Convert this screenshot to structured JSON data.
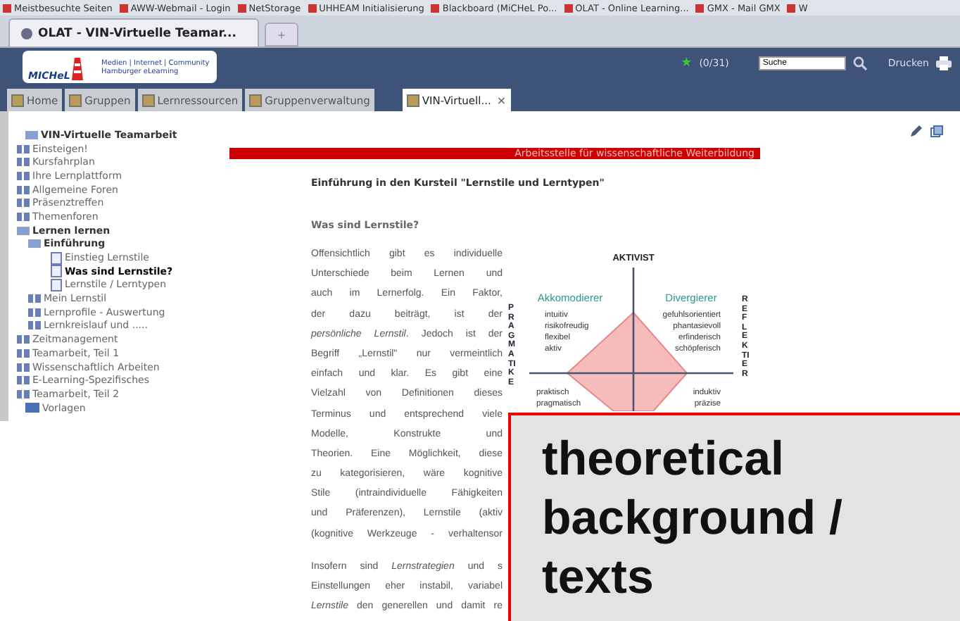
{
  "bookmarks": [
    "Meistbesuchte Seiten",
    "AWW-Webmail - Login",
    "NetStorage",
    "UHHEAM Initialisierung",
    "Blackboard (MiCHeL Po...",
    "OLAT - Online Learning...",
    "GMX - Mail GMX",
    "W"
  ],
  "browser_tab": {
    "title": "OLAT - VIN-Virtuelle Teamar...",
    "new_tab": "+"
  },
  "header": {
    "star": "★",
    "logo_name": "MICHeL",
    "logo_lines": [
      "Medien | Internet | Community",
      "Hamburger eLearning"
    ],
    "count": "(0/31)",
    "search": {
      "value": "Suche"
    },
    "print": "Drucken"
  },
  "tabs": [
    {
      "label": "Home",
      "selected": false
    },
    {
      "label": "Gruppen",
      "selected": false
    },
    {
      "label": "Lernressourcen",
      "selected": false
    },
    {
      "label": "Gruppenverwaltung",
      "selected": false
    },
    {
      "label": "VIN-Virtuell...",
      "selected": true,
      "close": "×"
    }
  ],
  "sidebar": {
    "items": [
      {
        "label": "VIN-Virtuelle Teamarbeit",
        "kind": "node",
        "expanded": true,
        "selected": false,
        "children": [
          {
            "label": "Einsteigen!",
            "kind": "node",
            "expanded": false,
            "selected": false
          },
          {
            "label": "Kursfahrplan",
            "kind": "node",
            "expanded": false,
            "selected": false
          },
          {
            "label": "Ihre Lernplattform",
            "kind": "node",
            "expanded": false,
            "selected": false
          },
          {
            "label": "Allgemeine Foren",
            "kind": "node",
            "expanded": false,
            "selected": false
          },
          {
            "label": "Präsenztreffen",
            "kind": "node",
            "expanded": false,
            "selected": false
          },
          {
            "label": "Themenforen",
            "kind": "node",
            "expanded": false,
            "selected": false
          },
          {
            "label": "Lernen lernen",
            "kind": "node",
            "expanded": true,
            "selected": false,
            "children": [
              {
                "label": "Einführung",
                "kind": "node",
                "expanded": true,
                "selected": false,
                "children": [
                  {
                    "label": "Einstieg Lernstile",
                    "kind": "page",
                    "expanded": false,
                    "selected": false
                  },
                  {
                    "label": "Was sind Lernstile?",
                    "kind": "page",
                    "expanded": false,
                    "selected": true
                  },
                  {
                    "label": "Lernstile / Lerntypen",
                    "kind": "page",
                    "expanded": false,
                    "selected": false
                  }
                ]
              },
              {
                "label": "Mein Lernstil",
                "kind": "node",
                "expanded": false,
                "selected": false
              },
              {
                "label": "Lernprofile - Auswertung",
                "kind": "node",
                "expanded": false,
                "selected": false
              },
              {
                "label": "Lernkreislauf und .....",
                "kind": "node",
                "expanded": false,
                "selected": false
              }
            ]
          },
          {
            "label": "Zeitmanagement",
            "kind": "node",
            "expanded": false,
            "selected": false
          },
          {
            "label": "Teamarbeit, Teil 1",
            "kind": "node",
            "expanded": false,
            "selected": false
          },
          {
            "label": "Wissenschaftlich Arbeiten",
            "kind": "node",
            "expanded": false,
            "selected": false
          },
          {
            "label": "E-Learning-Spezifisches",
            "kind": "node",
            "expanded": false,
            "selected": false
          },
          {
            "label": "Teamarbeit, Teil 2",
            "kind": "node",
            "expanded": false,
            "selected": false
          }
        ]
      },
      {
        "label": "Vorlagen",
        "kind": "folder",
        "expanded": false,
        "selected": false
      }
    ]
  },
  "content": {
    "banner": "Arbeitsstelle für wissenschaftliche Weiterbildung",
    "title": "Einführung in den Kursteil \"Lernstile und Lerntypen\"",
    "subtitle": "Was sind Lernstile?",
    "paragraphs": [
      [
        "Offensichtlich gibt es individuelle",
        "Unterschiede beim Lernen und",
        "auch im Lernerfolg. Ein Faktor,",
        "der dazu beiträgt, ist der",
        "*persönliche Lernstil*. Jedoch ist der",
        "Begriff „Lernstil\" nur vermeintlich",
        "einfach und klar. Es gibt eine",
        "Vielzahl von Definitionen dieses",
        "Terminus und entsprechend viele",
        "Modelle, Konstrukte und",
        "Theorien. Eine Möglichkeit, diese",
        "zu kategorisieren, wäre kognitive",
        "Stile (intraindividuelle Fähigkeiten",
        "und Präferenzen), Lernstile (aktiv",
        "(kognitive Werkzeuge - verhaltensor"
      ],
      [
        "Insofern sind *Lernstrategien* und s",
        "Einstellungen eher instabil, variabel",
        "*Lernstile* den generellen und damit re"
      ]
    ]
  },
  "diagram": {
    "top": "AKTIVIST",
    "left_axis": "PRAGMATIKE",
    "right_axis": "REFLEKTIER",
    "quadrants": [
      {
        "name": "Akkomodierer",
        "traits": [
          "intuitiv",
          "risikofreudig",
          "flexibel",
          "aktiv"
        ]
      },
      {
        "name": "Divergierer",
        "traits": [
          "gefuhlsorientiert",
          "phantasievoll",
          "erfinderisch",
          "schöpferisch"
        ]
      },
      {
        "traits": [
          "praktisch",
          "pragmatisch"
        ]
      },
      {
        "traits": [
          "induktiv",
          "präzise"
        ]
      }
    ]
  },
  "callout": {
    "lines": [
      "theoretical",
      "background /",
      "texts"
    ]
  }
}
